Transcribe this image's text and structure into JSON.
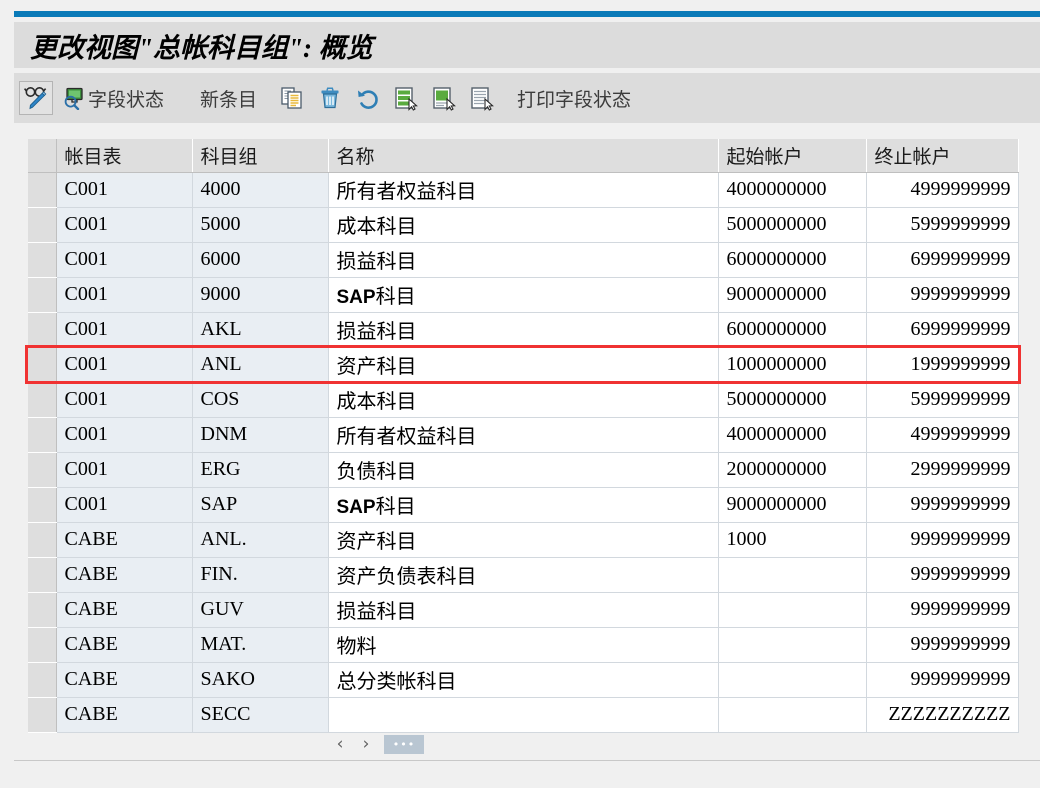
{
  "window": {
    "title": "更改视图\"总帐科目组\": 概览",
    "accent_color": "#0a7ab8",
    "titlebar_color": "#dcdcdc"
  },
  "toolbar": {
    "items": [
      {
        "name": "display-change-button",
        "icon": "glasses-pencil-icon",
        "label": ""
      },
      {
        "name": "field-status-button",
        "icon": "field-status-icon",
        "label": "字段状态"
      },
      {
        "name": "new-entries-button",
        "icon": "",
        "label": "新条目"
      },
      {
        "name": "copy-button",
        "icon": "copy-icon",
        "label": ""
      },
      {
        "name": "delete-button",
        "icon": "trash-icon",
        "label": ""
      },
      {
        "name": "undo-button",
        "icon": "undo-icon",
        "label": ""
      },
      {
        "name": "select-all-button",
        "icon": "select-block-green-icon",
        "label": ""
      },
      {
        "name": "select-block-button",
        "icon": "select-block-green2-icon",
        "label": ""
      },
      {
        "name": "deselect-button",
        "icon": "deselect-block-icon",
        "label": ""
      },
      {
        "name": "print-field-status-button",
        "icon": "",
        "label": "打印字段状态"
      }
    ],
    "field_status_label": "字段状态",
    "new_entries_label": "新条目",
    "print_field_status_label": "打印字段状态"
  },
  "table": {
    "columns": [
      {
        "key": "sel",
        "label": ""
      },
      {
        "key": "coa",
        "label": "帐目表"
      },
      {
        "key": "grp",
        "label": "科目组"
      },
      {
        "key": "name",
        "label": "名称"
      },
      {
        "key": "from",
        "label": "起始帐户"
      },
      {
        "key": "to",
        "label": "终止帐户"
      }
    ],
    "rows": [
      {
        "coa": "C001",
        "grp": "4000",
        "name": "所有者权益科目",
        "from": "4000000000",
        "to": "4999999999",
        "bold_prefix": ""
      },
      {
        "coa": "C001",
        "grp": "5000",
        "name": "成本科目",
        "from": "5000000000",
        "to": "5999999999",
        "bold_prefix": ""
      },
      {
        "coa": "C001",
        "grp": "6000",
        "name": "损益科目",
        "from": "6000000000",
        "to": "6999999999",
        "bold_prefix": ""
      },
      {
        "coa": "C001",
        "grp": "9000",
        "name": "科目",
        "from": "9000000000",
        "to": "9999999999",
        "bold_prefix": "SAP"
      },
      {
        "coa": "C001",
        "grp": "AKL",
        "name": "损益科目",
        "from": "6000000000",
        "to": "6999999999",
        "bold_prefix": ""
      },
      {
        "coa": "C001",
        "grp": "ANL",
        "name": "资产科目",
        "from": "1000000000",
        "to": "1999999999",
        "bold_prefix": ""
      },
      {
        "coa": "C001",
        "grp": "COS",
        "name": "成本科目",
        "from": "5000000000",
        "to": "5999999999",
        "bold_prefix": ""
      },
      {
        "coa": "C001",
        "grp": "DNM",
        "name": "所有者权益科目",
        "from": "4000000000",
        "to": "4999999999",
        "bold_prefix": ""
      },
      {
        "coa": "C001",
        "grp": "ERG",
        "name": "负债科目",
        "from": "2000000000",
        "to": "2999999999",
        "bold_prefix": ""
      },
      {
        "coa": "C001",
        "grp": "SAP",
        "name": "科目",
        "from": "9000000000",
        "to": "9999999999",
        "bold_prefix": "SAP"
      },
      {
        "coa": "CABE",
        "grp": "ANL.",
        "name": "资产科目",
        "from": "1000",
        "to": "9999999999",
        "bold_prefix": ""
      },
      {
        "coa": "CABE",
        "grp": "FIN.",
        "name": "资产负债表科目",
        "from": "",
        "to": "9999999999",
        "bold_prefix": ""
      },
      {
        "coa": "CABE",
        "grp": "GUV",
        "name": "损益科目",
        "from": "",
        "to": "9999999999",
        "bold_prefix": ""
      },
      {
        "coa": "CABE",
        "grp": "MAT.",
        "name": "物料",
        "from": "",
        "to": "9999999999",
        "bold_prefix": ""
      },
      {
        "coa": "CABE",
        "grp": "SAKO",
        "name": "总分类帐科目",
        "from": "",
        "to": "9999999999",
        "bold_prefix": ""
      },
      {
        "coa": "CABE",
        "grp": "SECC",
        "name": "",
        "from": "",
        "to": "ZZZZZZZZZZ",
        "bold_prefix": ""
      }
    ],
    "highlight": {
      "row_index": 5,
      "color": "#f03232"
    },
    "focused_cell": {
      "row_index": 10,
      "column": "grp",
      "color": "#9c1c1c"
    }
  },
  "pager": {
    "prev_label": "‹",
    "next_label": "›",
    "more_label": "•••"
  }
}
